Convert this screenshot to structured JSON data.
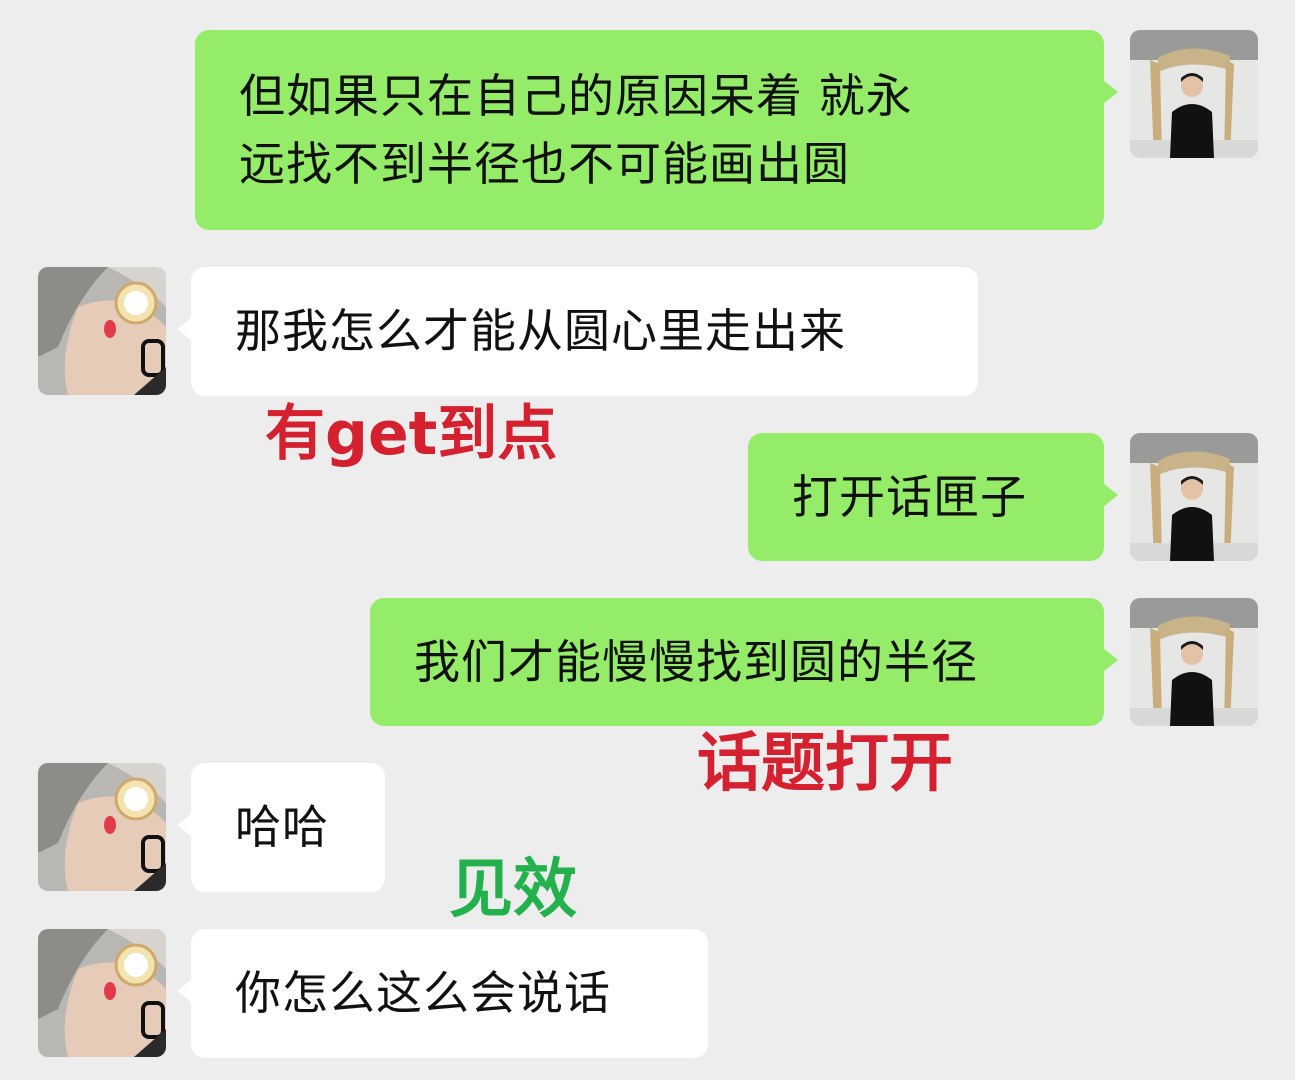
{
  "colors": {
    "background": "#ededed",
    "sent_bubble": "#95ec69",
    "received_bubble": "#ffffff",
    "annotation_red": "#d4202f",
    "annotation_green": "#22b14c"
  },
  "avatars": {
    "self": "man-in-black-avatar",
    "contact": "woman-cover-face-avatar"
  },
  "messages": [
    {
      "side": "sent",
      "text": "但如果只在自己的原因呆着 就永\n远找不到半径也不可能画出圆"
    },
    {
      "side": "received",
      "text": "那我怎么才能从圆心里走出来"
    },
    {
      "side": "sent",
      "text": "打开话匣子"
    },
    {
      "side": "sent",
      "text": "我们才能慢慢找到圆的半径"
    },
    {
      "side": "received",
      "text": "哈哈"
    },
    {
      "side": "received",
      "text": "你怎么这么会说话"
    }
  ],
  "annotations": {
    "note1": "有get到点",
    "note2": "话题打开",
    "note3": "见效"
  }
}
